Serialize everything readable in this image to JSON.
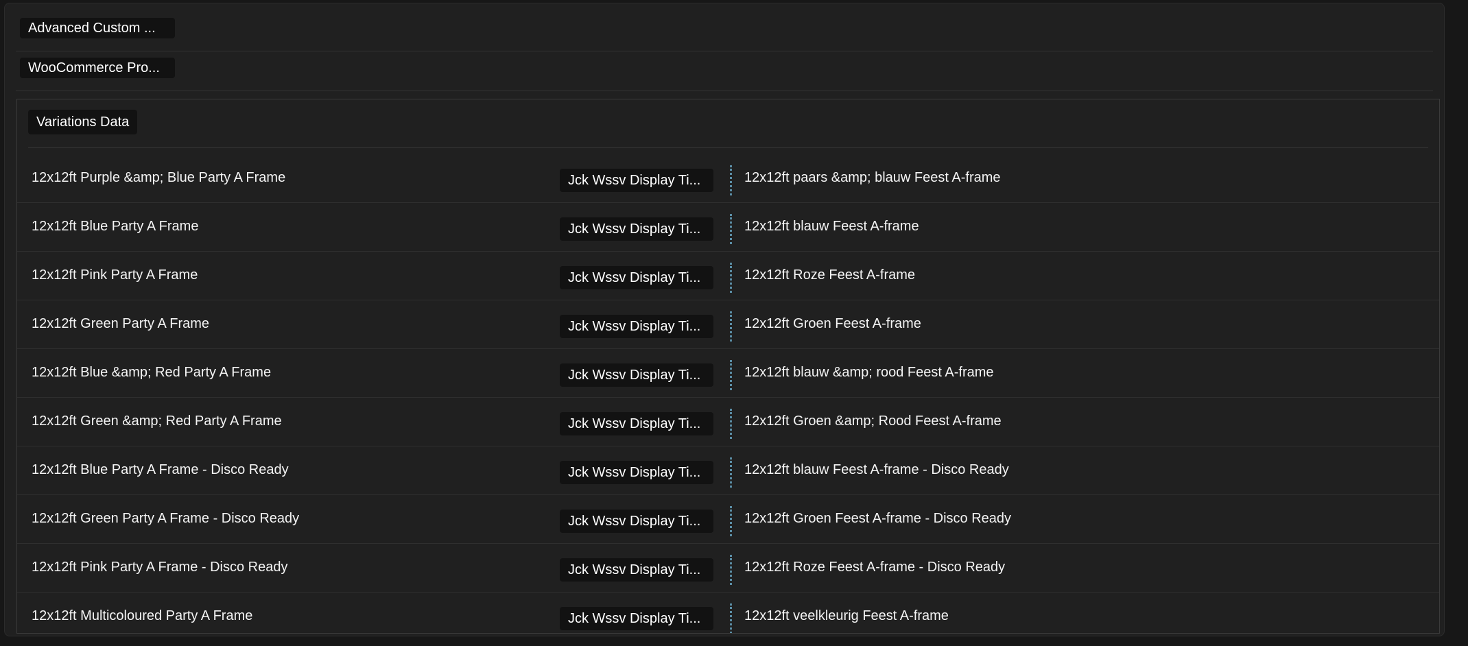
{
  "sections": [
    {
      "label": "Advanced Custom ..."
    },
    {
      "label": "WooCommerce Pro..."
    }
  ],
  "variations": {
    "label": "Variations Data",
    "rows": [
      {
        "source": "12x12ft Purple &amp; Blue Party A Frame",
        "field": "Jck Wssv Display Ti...",
        "translation": "12x12ft paars &amp; blauw Feest A-frame"
      },
      {
        "source": "12x12ft Blue Party A Frame",
        "field": "Jck Wssv Display Ti...",
        "translation": "12x12ft blauw Feest A-frame"
      },
      {
        "source": "12x12ft Pink Party A Frame",
        "field": "Jck Wssv Display Ti...",
        "translation": "12x12ft Roze Feest A-frame"
      },
      {
        "source": "12x12ft Green Party A Frame",
        "field": "Jck Wssv Display Ti...",
        "translation": "12x12ft Groen Feest A-frame"
      },
      {
        "source": "12x12ft Blue &amp; Red Party A Frame",
        "field": "Jck Wssv Display Ti...",
        "translation": "12x12ft blauw &amp; rood Feest A-frame"
      },
      {
        "source": "12x12ft Green &amp; Red Party A Frame",
        "field": "Jck Wssv Display Ti...",
        "translation": "12x12ft Groen &amp; Rood Feest A-frame"
      },
      {
        "source": "12x12ft Blue Party A Frame - Disco Ready",
        "field": "Jck Wssv Display Ti...",
        "translation": "12x12ft blauw Feest A-frame - Disco Ready"
      },
      {
        "source": "12x12ft Green Party A Frame - Disco Ready",
        "field": "Jck Wssv Display Ti...",
        "translation": "12x12ft Groen Feest A-frame - Disco Ready"
      },
      {
        "source": "12x12ft Pink Party A Frame - Disco Ready",
        "field": "Jck Wssv Display Ti...",
        "translation": "12x12ft Roze Feest A-frame - Disco Ready"
      },
      {
        "source": "12x12ft Multicoloured Party A Frame",
        "field": "Jck Wssv Display Ti...",
        "translation": "12x12ft veelkleurig Feest A-frame"
      }
    ]
  }
}
